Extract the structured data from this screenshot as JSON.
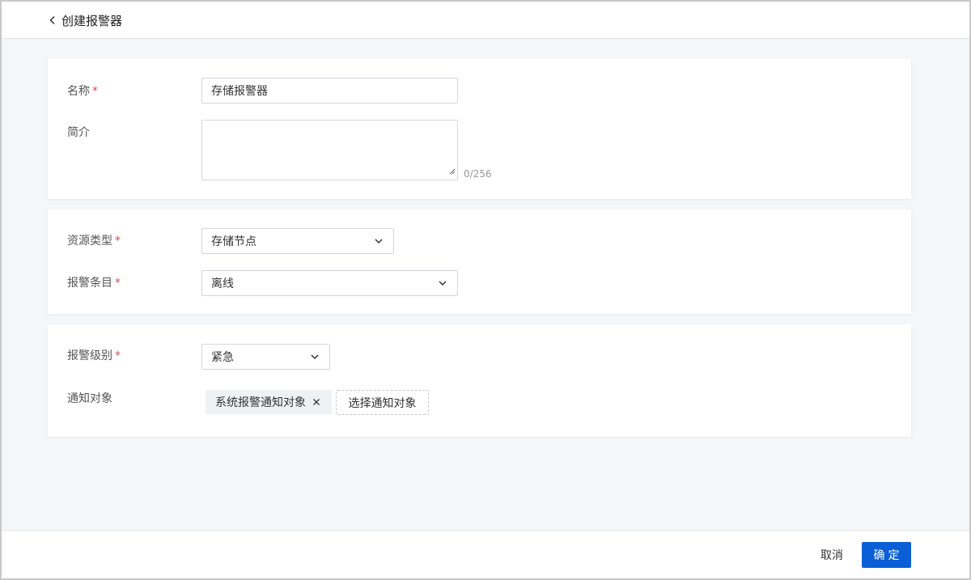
{
  "header": {
    "title": "创建报警器"
  },
  "form": {
    "name": {
      "label": "名称",
      "required_mark": "*",
      "value": "存储报警器"
    },
    "description": {
      "label": "简介",
      "value": "",
      "counter": "0/256"
    },
    "resource_type": {
      "label": "资源类型",
      "required_mark": "*",
      "value": "存储节点"
    },
    "alarm_item": {
      "label": "报警条目",
      "required_mark": "*",
      "value": "离线"
    },
    "alarm_level": {
      "label": "报警级别",
      "required_mark": "*",
      "value": "紧急"
    },
    "notify_target": {
      "label": "通知对象",
      "tags": [
        "系统报警通知对象"
      ],
      "add_label": "选择通知对象"
    }
  },
  "footer": {
    "cancel_label": "取消",
    "ok_label": "确定"
  },
  "colors": {
    "primary": "#0a5fd6",
    "required": "#e5484d",
    "background": "#f5f6f8"
  },
  "icons": {
    "back": "chevron-left-icon",
    "dropdown": "chevron-down-icon",
    "tag_close": "close-icon",
    "resize": "resize-handle-icon"
  }
}
